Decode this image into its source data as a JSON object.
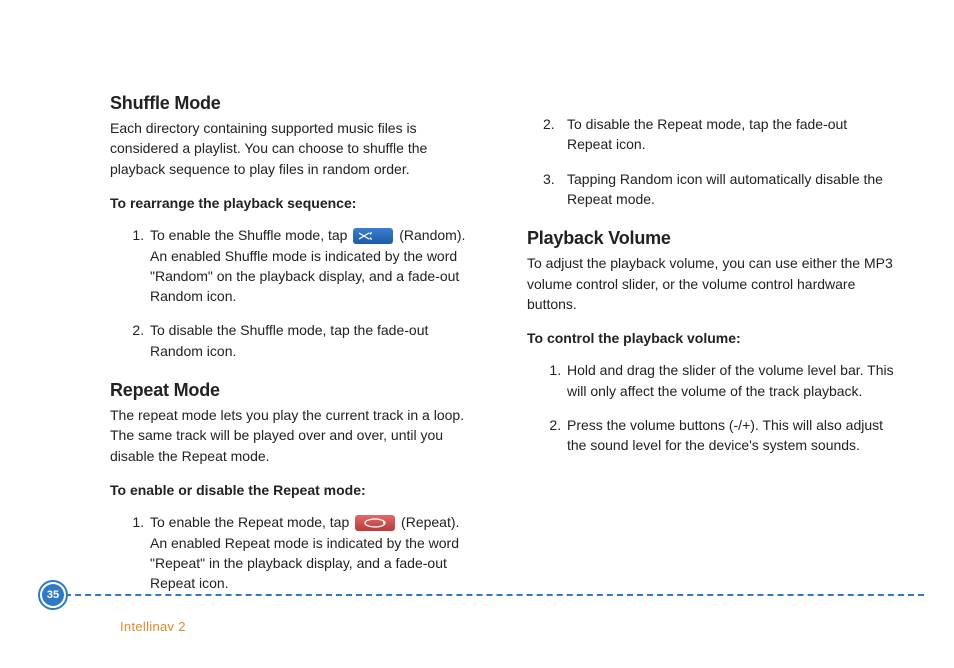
{
  "left": {
    "shuffle": {
      "heading": "Shuffle Mode",
      "intro": "Each directory containing supported music files is considered a playlist. You can choose to shuffle the playback sequence to play files in random order.",
      "sub": "To rearrange the playback sequence:",
      "step1_pre": "To enable the Shuffle mode, tap",
      "step1_post": "(Random). An enabled Shuffle mode is indicated by the word \"Random\" on the playback display, and a fade-out Random icon.",
      "step2": "To disable the Shuffle mode, tap the fade-out Random icon."
    },
    "repeat": {
      "heading": "Repeat Mode",
      "intro": "The repeat mode lets you play the current track in a loop. The same track will be played over and over, until you disable the Repeat mode.",
      "sub": "To enable or disable the Repeat mode:",
      "step1_pre": "To enable the Repeat mode, tap",
      "step1_post": "(Repeat). An enabled Repeat mode is indicated by the word \"Repeat\" in the playback display, and a fade-out Repeat icon."
    }
  },
  "right": {
    "repeat_cont": {
      "step2": "To disable the Repeat mode, tap the fade-out Repeat icon.",
      "step3": "Tapping Random icon will automatically disable the Repeat mode."
    },
    "volume": {
      "heading": "Playback Volume",
      "intro": "To adjust the playback volume, you can use either the MP3 volume control slider, or the volume control hardware buttons.",
      "sub": "To control the playback volume:",
      "step1": "Hold and drag the slider of the volume level bar. This will only affect the volume of the track playback.",
      "step2": "Press the volume buttons (-/+). This will also adjust the sound level for the device's system sounds."
    }
  },
  "footer": {
    "page": "35",
    "brand": "Intellinav 2"
  }
}
